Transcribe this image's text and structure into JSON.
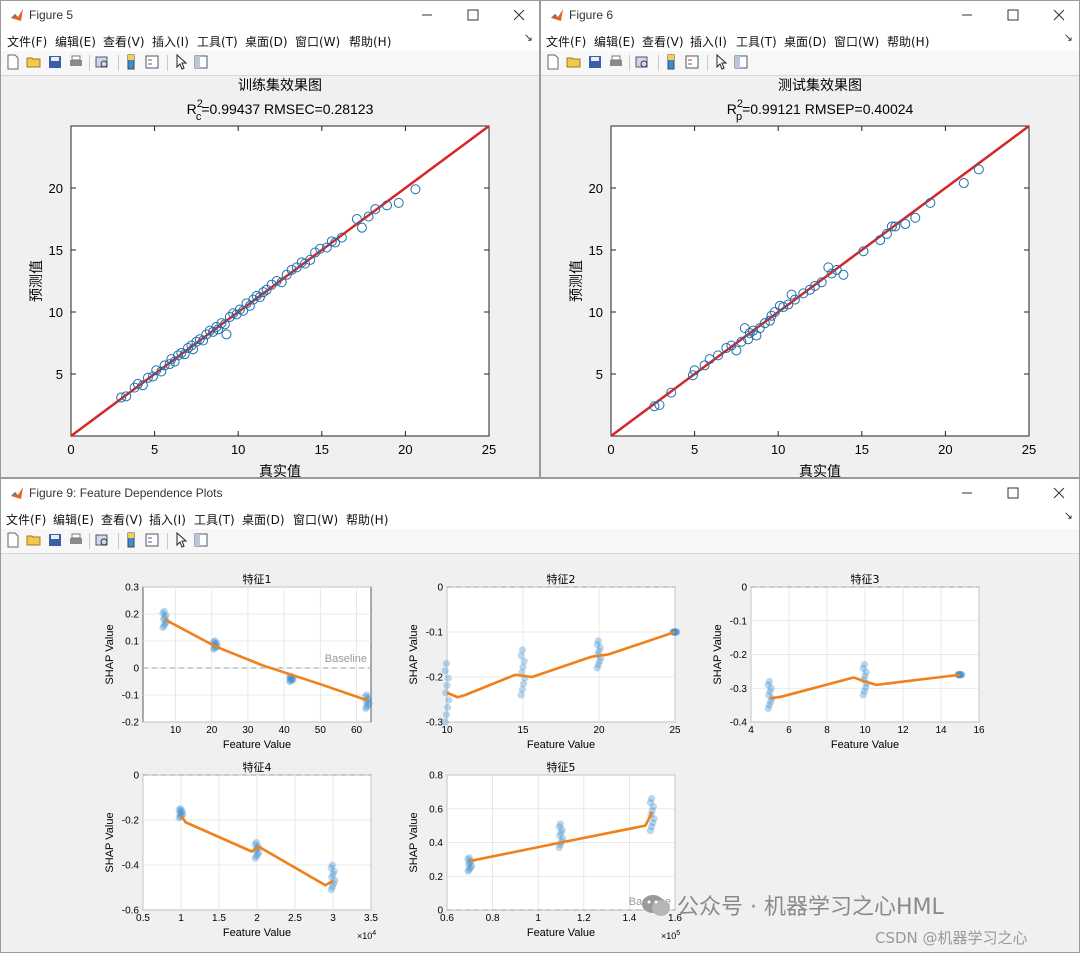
{
  "colors": {
    "regression_line": "#d62728",
    "marker_edge": "#1f6fa8",
    "shap_point": "#3b8fd0",
    "trend_line": "#f0801a",
    "baseline": "#b0b0b0"
  },
  "menu": [
    "文件(F)",
    "编辑(E)",
    "查看(V)",
    "插入(I)",
    "工具(T)",
    "桌面(D)",
    "窗口(W)",
    "帮助(H)"
  ],
  "toolbar_icons": [
    "new-file-icon",
    "open-folder-icon",
    "save-icon",
    "print-icon",
    "print-preview-icon",
    "colorbar-icon",
    "legend-icon",
    "pointer-icon",
    "property-editor-icon"
  ],
  "menu_arrow": "↘",
  "fig5": {
    "window_title": "Figure 5",
    "title_line1": "训练集效果图",
    "title_line2_prefix": "R",
    "title_line2_sub": "c",
    "title_line2_sup": "2",
    "title_line2_rest": "=0.99437  RMSEC=0.28123"
  },
  "fig6": {
    "window_title": "Figure 6",
    "title_line1": "测试集效果图",
    "title_line2_prefix": "R",
    "title_line2_sub": "p",
    "title_line2_sup": "2",
    "title_line2_rest": "=0.99121  RMSEP=0.40024"
  },
  "fig9": {
    "window_title": "Figure 9: Feature Dependence Plots"
  },
  "watermark": {
    "wechat": "公众号 · 机器学习之心HML",
    "csdn": "CSDN @机器学习之心"
  },
  "chart_data": [
    {
      "type": "scatter",
      "title": "训练集效果图",
      "subtitle": "R_c^2=0.99437  RMSEC=0.28123",
      "xlabel": "真实值",
      "ylabel": "预测值",
      "xlim": [
        0,
        25
      ],
      "ylim": [
        0,
        25
      ],
      "xticks": [
        0,
        5,
        10,
        15,
        20,
        25
      ],
      "yticks": [
        5,
        10,
        15,
        20
      ],
      "reference_line": {
        "x": [
          0,
          25
        ],
        "y": [
          0,
          25
        ]
      },
      "points": [
        [
          3.0,
          3.1
        ],
        [
          3.3,
          3.2
        ],
        [
          3.8,
          3.9
        ],
        [
          4.0,
          4.2
        ],
        [
          4.3,
          4.1
        ],
        [
          4.6,
          4.7
        ],
        [
          4.9,
          4.8
        ],
        [
          5.1,
          5.3
        ],
        [
          5.4,
          5.2
        ],
        [
          5.6,
          5.7
        ],
        [
          5.9,
          5.8
        ],
        [
          6.0,
          6.2
        ],
        [
          6.2,
          6.0
        ],
        [
          6.4,
          6.5
        ],
        [
          6.6,
          6.7
        ],
        [
          6.8,
          6.6
        ],
        [
          7.0,
          7.1
        ],
        [
          7.2,
          7.3
        ],
        [
          7.3,
          7.0
        ],
        [
          7.5,
          7.6
        ],
        [
          7.7,
          7.8
        ],
        [
          7.9,
          7.7
        ],
        [
          8.1,
          8.2
        ],
        [
          8.3,
          8.5
        ],
        [
          8.5,
          8.4
        ],
        [
          8.7,
          8.8
        ],
        [
          8.8,
          8.6
        ],
        [
          9.0,
          9.1
        ],
        [
          9.2,
          9.0
        ],
        [
          9.3,
          8.2
        ],
        [
          9.5,
          9.6
        ],
        [
          9.7,
          9.9
        ],
        [
          9.9,
          9.8
        ],
        [
          10.1,
          10.2
        ],
        [
          10.3,
          10.1
        ],
        [
          10.5,
          10.7
        ],
        [
          10.7,
          10.5
        ],
        [
          10.9,
          11.0
        ],
        [
          11.1,
          11.3
        ],
        [
          11.3,
          11.2
        ],
        [
          11.5,
          11.6
        ],
        [
          11.7,
          11.8
        ],
        [
          12.0,
          12.2
        ],
        [
          12.3,
          12.5
        ],
        [
          12.6,
          12.4
        ],
        [
          12.9,
          13.0
        ],
        [
          13.2,
          13.4
        ],
        [
          13.5,
          13.6
        ],
        [
          13.8,
          14.0
        ],
        [
          14.0,
          13.9
        ],
        [
          14.3,
          14.2
        ],
        [
          14.6,
          14.8
        ],
        [
          14.9,
          15.1
        ],
        [
          15.3,
          15.2
        ],
        [
          15.6,
          15.7
        ],
        [
          15.8,
          15.6
        ],
        [
          16.2,
          16.0
        ],
        [
          17.1,
          17.5
        ],
        [
          17.4,
          16.8
        ],
        [
          17.8,
          17.7
        ],
        [
          18.2,
          18.3
        ],
        [
          18.9,
          18.6
        ],
        [
          19.6,
          18.8
        ],
        [
          20.6,
          19.9
        ]
      ]
    },
    {
      "type": "scatter",
      "title": "测试集效果图",
      "subtitle": "R_p^2=0.99121  RMSEP=0.40024",
      "xlabel": "真实值",
      "ylabel": "预测值",
      "xlim": [
        0,
        25
      ],
      "ylim": [
        0,
        25
      ],
      "xticks": [
        0,
        5,
        10,
        15,
        20,
        25
      ],
      "yticks": [
        5,
        10,
        15,
        20
      ],
      "reference_line": {
        "x": [
          0,
          25
        ],
        "y": [
          0,
          25
        ]
      },
      "points": [
        [
          2.6,
          2.4
        ],
        [
          2.9,
          2.5
        ],
        [
          3.6,
          3.5
        ],
        [
          4.9,
          4.9
        ],
        [
          5.0,
          5.3
        ],
        [
          5.6,
          5.7
        ],
        [
          5.9,
          6.2
        ],
        [
          6.4,
          6.5
        ],
        [
          6.9,
          7.1
        ],
        [
          7.2,
          7.3
        ],
        [
          7.5,
          6.9
        ],
        [
          7.8,
          7.6
        ],
        [
          8.0,
          8.7
        ],
        [
          8.2,
          7.8
        ],
        [
          8.3,
          8.3
        ],
        [
          8.5,
          8.5
        ],
        [
          8.7,
          8.1
        ],
        [
          8.9,
          8.7
        ],
        [
          9.2,
          9.1
        ],
        [
          9.5,
          9.3
        ],
        [
          9.6,
          9.7
        ],
        [
          9.8,
          10.0
        ],
        [
          10.1,
          10.5
        ],
        [
          10.3,
          10.4
        ],
        [
          10.6,
          10.6
        ],
        [
          10.8,
          11.4
        ],
        [
          11.0,
          11.0
        ],
        [
          11.5,
          11.5
        ],
        [
          11.9,
          11.8
        ],
        [
          12.2,
          12.1
        ],
        [
          12.6,
          12.4
        ],
        [
          13.0,
          13.6
        ],
        [
          13.2,
          13.1
        ],
        [
          13.5,
          13.4
        ],
        [
          13.9,
          13.0
        ],
        [
          15.1,
          14.9
        ],
        [
          16.1,
          15.8
        ],
        [
          16.5,
          16.3
        ],
        [
          16.8,
          16.9
        ],
        [
          17.0,
          16.9
        ],
        [
          17.6,
          17.1
        ],
        [
          18.2,
          17.6
        ],
        [
          19.1,
          18.8
        ],
        [
          21.1,
          20.4
        ],
        [
          22.0,
          21.5
        ]
      ]
    },
    {
      "type": "scatter",
      "title": "特征1",
      "xlabel": "Feature Value",
      "ylabel": "SHAP Value",
      "xlim": [
        1,
        64
      ],
      "ylim": [
        -0.2,
        0.3
      ],
      "xticks": [
        10,
        20,
        30,
        40,
        50,
        60
      ],
      "yticks": [
        -0.2,
        -0.1,
        0,
        0.1,
        0.2,
        0.3
      ],
      "baseline": {
        "y": 0,
        "label": "Baseline"
      },
      "clusters": [
        {
          "x": 7,
          "y": [
            0.15,
            0.21
          ]
        },
        {
          "x": 21,
          "y": [
            0.07,
            0.1
          ]
        },
        {
          "x": 42,
          "y": [
            -0.05,
            -0.03
          ]
        },
        {
          "x": 63,
          "y": [
            -0.15,
            -0.1
          ]
        }
      ],
      "trend": {
        "x": [
          7,
          21,
          34,
          50,
          63
        ],
        "y": [
          0.18,
          0.08,
          0.01,
          -0.06,
          -0.12
        ]
      }
    },
    {
      "type": "scatter",
      "title": "特征2",
      "xlabel": "Feature Value",
      "ylabel": "SHAP Value",
      "xlim": [
        10,
        25
      ],
      "ylim": [
        -0.3,
        0
      ],
      "xticks": [
        10,
        15,
        20,
        25
      ],
      "yticks": [
        -0.3,
        -0.2,
        -0.1,
        0
      ],
      "baseline": {
        "y": 0
      },
      "clusters": [
        {
          "x": 10,
          "y": [
            -0.3,
            -0.17
          ]
        },
        {
          "x": 15,
          "y": [
            -0.24,
            -0.14
          ]
        },
        {
          "x": 20,
          "y": [
            -0.18,
            -0.12
          ]
        },
        {
          "x": 25,
          "y": [
            -0.1,
            -0.1
          ]
        }
      ],
      "trend": {
        "x": [
          10,
          10.7,
          11.2,
          14.5,
          15.6,
          19.5,
          20.6,
          25
        ],
        "y": [
          -0.235,
          -0.245,
          -0.24,
          -0.195,
          -0.2,
          -0.155,
          -0.15,
          -0.1
        ]
      }
    },
    {
      "type": "scatter",
      "title": "特征3",
      "xlabel": "Feature Value",
      "ylabel": "SHAP Value",
      "xlim": [
        4,
        16
      ],
      "ylim": [
        -0.4,
        0
      ],
      "xticks": [
        4,
        6,
        8,
        10,
        12,
        14,
        16
      ],
      "yticks": [
        -0.4,
        -0.3,
        -0.2,
        -0.1,
        0
      ],
      "baseline": {
        "y": 0
      },
      "clusters": [
        {
          "x": 5,
          "y": [
            -0.36,
            -0.28
          ]
        },
        {
          "x": 10,
          "y": [
            -0.32,
            -0.23
          ]
        },
        {
          "x": 15,
          "y": [
            -0.26,
            -0.26
          ]
        }
      ],
      "trend": {
        "x": [
          5,
          5.6,
          9.4,
          10,
          10.6,
          15
        ],
        "y": [
          -0.33,
          -0.325,
          -0.268,
          -0.28,
          -0.29,
          -0.26
        ]
      }
    },
    {
      "type": "scatter",
      "title": "特征4",
      "xlabel": "Feature Value",
      "ylabel": "SHAP Value",
      "xlim": [
        5000,
        35000
      ],
      "ylim": [
        -0.6,
        0
      ],
      "x_multiplier": "×10^4",
      "xticks": [
        5000,
        10000,
        15000,
        20000,
        25000,
        30000,
        35000
      ],
      "xtick_labels": [
        "0.5",
        "1",
        "1.5",
        "2",
        "2.5",
        "3",
        "3.5"
      ],
      "yticks": [
        -0.6,
        -0.4,
        -0.2,
        0
      ],
      "baseline": {
        "y": 0
      },
      "clusters": [
        {
          "x": 10000,
          "y": [
            -0.19,
            -0.15
          ]
        },
        {
          "x": 20000,
          "y": [
            -0.37,
            -0.3
          ]
        },
        {
          "x": 30000,
          "y": [
            -0.51,
            -0.4
          ]
        }
      ],
      "trend": {
        "x": [
          10000,
          10600,
          19300,
          20300,
          29000,
          30000
        ],
        "y": [
          -0.18,
          -0.21,
          -0.34,
          -0.32,
          -0.49,
          -0.47
        ]
      }
    },
    {
      "type": "scatter",
      "title": "特征5",
      "xlabel": "Feature Value",
      "ylabel": "SHAP Value",
      "xlim": [
        60000,
        160000
      ],
      "ylim": [
        0,
        0.8
      ],
      "x_multiplier": "×10^5",
      "xticks": [
        60000,
        80000,
        100000,
        120000,
        140000,
        160000
      ],
      "xtick_labels": [
        "0.6",
        "0.8",
        "1",
        "1.2",
        "1.4",
        "1.6"
      ],
      "yticks": [
        0,
        0.2,
        0.4,
        0.6,
        0.8
      ],
      "baseline": {
        "y": 0,
        "label": "Baseline"
      },
      "clusters": [
        {
          "x": 70000,
          "y": [
            0.23,
            0.31
          ]
        },
        {
          "x": 110000,
          "y": [
            0.37,
            0.51
          ]
        },
        {
          "x": 150000,
          "y": [
            0.47,
            0.66
          ]
        }
      ],
      "trend": {
        "x": [
          70000,
          110000,
          147000,
          150000
        ],
        "y": [
          0.29,
          0.4,
          0.5,
          0.58
        ]
      }
    }
  ]
}
